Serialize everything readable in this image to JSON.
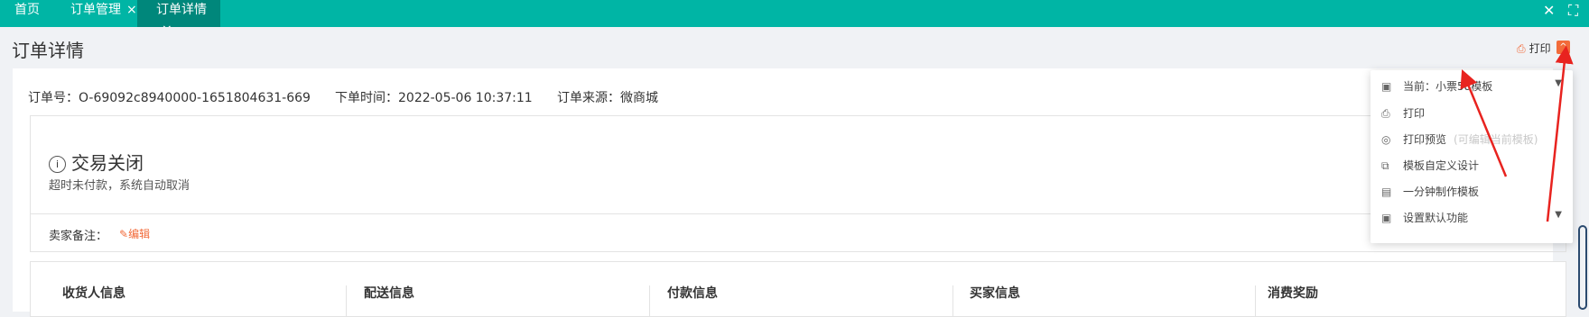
{
  "tabs": [
    {
      "label": "首页"
    },
    {
      "label": "订单管理",
      "close": "×"
    },
    {
      "label": "订单详情",
      "close": "×"
    }
  ],
  "topbar": {
    "close_icon": "✕",
    "fullscreen_icon": "⛶",
    "color": "#00b5a5",
    "active_tab_color": "#00877b"
  },
  "page": {
    "title": "订单详情",
    "print_label": "打印",
    "collapse_icon": "^"
  },
  "order": {
    "number": "订单号：O-69092c8940000-1651804631-669",
    "time": "下单时间：2022-05-06 10:37:11",
    "source": "订单来源：微商城"
  },
  "status": {
    "title": "交易关闭",
    "subtitle": "超时未付款，系统自动取消",
    "seller_note_label": "卖家备注：",
    "edit_label": "编辑"
  },
  "info_columns": [
    "收货人信息",
    "配送信息",
    "付款信息",
    "买家信息",
    "消费奖励"
  ],
  "dropdown": {
    "current": "当前：小票58模板",
    "print": "打印",
    "preview": "打印预览",
    "preview_hint": "(可编辑当前模板)",
    "custom_design": "模板自定义设计",
    "quick_make": "一分钟制作模板",
    "set_default": "设置默认功能"
  },
  "accent_color": "#f26b3a"
}
